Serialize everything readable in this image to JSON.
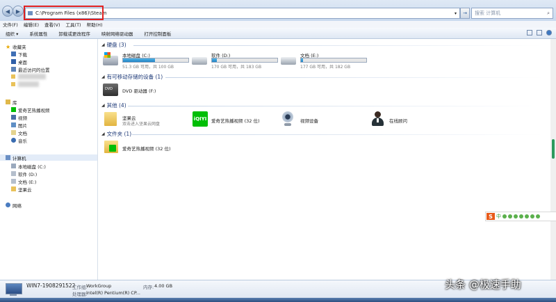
{
  "address": {
    "path": "C:\\Program Files (x86)\\Steam"
  },
  "search": {
    "placeholder": "搜索 计算机"
  },
  "menu": [
    "文件(F)",
    "编辑(E)",
    "查看(V)",
    "工具(T)",
    "帮助(H)"
  ],
  "toolbar": [
    "组织 ▾",
    "系统属性",
    "卸载或更改程序",
    "映射网络驱动器",
    "打开控制面板"
  ],
  "nav": {
    "favorites": {
      "label": "收藏夹",
      "items": [
        "下载",
        "桌面",
        "最近访问的位置"
      ]
    },
    "library": {
      "label": "库",
      "items": [
        "爱奇艺热播视频",
        "视频",
        "图片",
        "文档",
        "音乐"
      ]
    },
    "computer": {
      "label": "计算机",
      "items": [
        "本地磁盘 (C:)",
        "软件 (D:)",
        "文档 (E:)",
        "坚果云"
      ]
    },
    "network": "网络"
  },
  "groups": {
    "hdd": "硬盘 (3)",
    "removable": "有可移动存储的设备 (1)",
    "other": "其他 (4)",
    "folders": "文件夹 (1)"
  },
  "drives": [
    {
      "name": "本地磁盘 (C:)",
      "free": "51.3 GB 可用，共 100 GB",
      "used_fraction": 0.49
    },
    {
      "name": "软件 (D:)",
      "free": "170 GB 可用，共 183 GB",
      "used_fraction": 0.07
    },
    {
      "name": "文档 (E:)",
      "free": "177 GB 可用，共 182 GB",
      "used_fraction": 0.03
    }
  ],
  "dvd": {
    "name": "DVD 驱动器 (F:)"
  },
  "other": [
    {
      "name": "坚果云",
      "sub": "双击进入坚果云网盘"
    },
    {
      "name": "爱奇艺热播视频 (32 位)"
    },
    {
      "name": "视频设备"
    },
    {
      "name": "在线顾问"
    }
  ],
  "folder": {
    "name": "爱奇艺热播视频 (32 位)"
  },
  "details": {
    "pc_name": "WIN7-1908291522",
    "workgroup_label": "工作组:",
    "workgroup": "WorkGroup",
    "memory_label": "内存:",
    "memory": "4.00 GB",
    "cpu_label": "处理器:",
    "cpu": "Intel(R) Pentium(R) CP..."
  },
  "ime": {
    "label": "中"
  },
  "watermark": "头条 @极速手助",
  "colors": {
    "accent": "#2384c6",
    "highlight": "#e02020",
    "iqiyi": "#00be06"
  }
}
